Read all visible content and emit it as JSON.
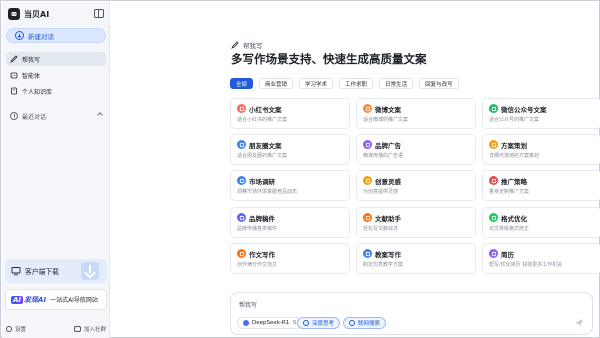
{
  "app": {
    "name": "当贝AI"
  },
  "sidebar": {
    "new_chat": "新建对话",
    "items": [
      {
        "label": "帮我写",
        "icon": "pen-icon"
      },
      {
        "label": "智能体",
        "icon": "agent-icon"
      },
      {
        "label": "个人知识库",
        "icon": "book-icon"
      }
    ],
    "recent_label": "最近对话",
    "download_label": "客户端下载",
    "banner": {
      "brand_ai": "AI",
      "brand_text": "发现AI",
      "tagline": "一站式AI导航网站"
    },
    "settings_label": "设置",
    "community_label": "加入社群"
  },
  "main": {
    "section_label": "帮我写",
    "title": "多写作场景支持、快速生成高质量文案",
    "tabs": [
      "全部",
      "商业营销",
      "学习学术",
      "工作求职",
      "日常生活",
      "回复与改写"
    ],
    "cards": [
      {
        "title": "小红书文案",
        "desc": "适合小红书的推广文案",
        "color": "#f56b5b",
        "icon": "book-icon"
      },
      {
        "title": "微博文案",
        "desc": "适合微博的推广文案",
        "color": "#f58b3b",
        "icon": "weibo-icon"
      },
      {
        "title": "微信公众号文案",
        "desc": "适合公众号的推广文案",
        "color": "#28b66c",
        "icon": "wechat-icon"
      },
      {
        "title": "朋友圈文案",
        "desc": "适合朋友圈的推广文案",
        "color": "#3b82f6",
        "icon": "moments-icon"
      },
      {
        "title": "品牌广告",
        "desc": "精准传播的广告语",
        "color": "#8b5cf6",
        "icon": "megaphone-icon"
      },
      {
        "title": "方案策划",
        "desc": "详细可落地的方案策划",
        "color": "#f59e0b",
        "icon": "plan-icon"
      },
      {
        "title": "市场调研",
        "desc": "洞察市场环境掌握竞品动态",
        "color": "#3b82f6",
        "icon": "chart-icon"
      },
      {
        "title": "创意灵感",
        "desc": "为创意提供灵感",
        "color": "#f59e0b",
        "icon": "bulb-icon"
      },
      {
        "title": "推广策略",
        "desc": "量身定制推广方案",
        "color": "#ef4444",
        "icon": "target-icon"
      },
      {
        "title": "品牌稿件",
        "desc": "品牌传播各类稿件",
        "color": "#6366f1",
        "icon": "document-icon"
      },
      {
        "title": "文献助手",
        "desc": "轻松写文献综述",
        "color": "#f97316",
        "icon": "literature-icon"
      },
      {
        "title": "格式优化",
        "desc": "论文排版格式修正",
        "color": "#22c55e",
        "icon": "format-icon"
      },
      {
        "title": "作文写作",
        "desc": "创作满分作文范文",
        "color": "#f97316",
        "icon": "essay-icon"
      },
      {
        "title": "教案写作",
        "desc": "制定优秀教学方案",
        "color": "#3b82f6",
        "icon": "lesson-icon"
      },
      {
        "title": "简历",
        "desc": "帮写/优化简历 获取更多工作机会",
        "color": "#8b5cf6",
        "icon": "resume-icon"
      }
    ]
  },
  "input": {
    "placeholder": "帮我写",
    "model": "DeepSeek-R1",
    "deep_think": "深度思考",
    "web_search": "联网搜索"
  }
}
